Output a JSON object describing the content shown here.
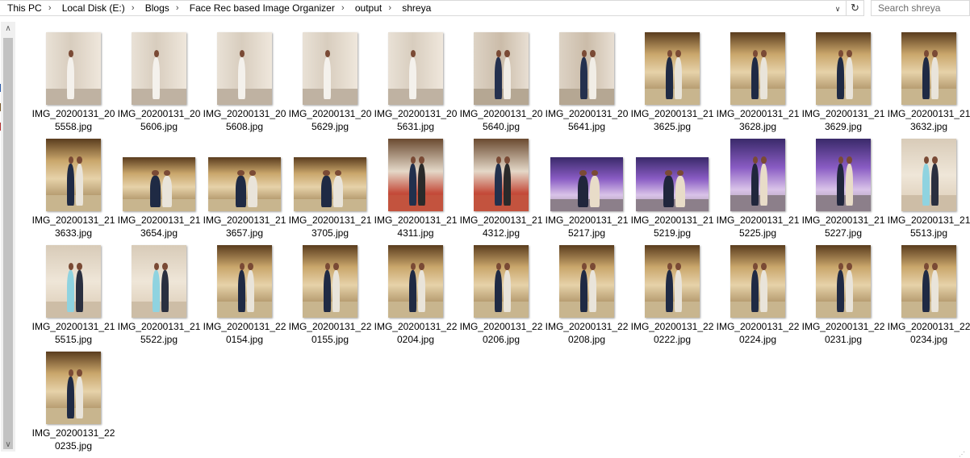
{
  "window": {
    "breadcrumbs": [
      "This PC",
      "Local Disk (E:)",
      "Blogs",
      "Face Rec based Image Organizer",
      "output",
      "shreya"
    ],
    "search_placeholder": "Search shreya",
    "icons": {
      "separator": "›",
      "dropdown": "∨",
      "refresh": "↻",
      "scroll_up": "∧",
      "scroll_down": "∨"
    },
    "colors": {
      "accent": "#1a73e8",
      "scrollbar_thumb": "#c2c2c2"
    }
  },
  "files": [
    {
      "name": "IMG_20200131_205558.jpg",
      "orient": "portrait",
      "tone": "hall"
    },
    {
      "name": "IMG_20200131_205606.jpg",
      "orient": "portrait",
      "tone": "hall"
    },
    {
      "name": "IMG_20200131_205608.jpg",
      "orient": "portrait",
      "tone": "hall"
    },
    {
      "name": "IMG_20200131_205629.jpg",
      "orient": "portrait",
      "tone": "hall"
    },
    {
      "name": "IMG_20200131_205631.jpg",
      "orient": "portrait",
      "tone": "hall"
    },
    {
      "name": "IMG_20200131_205640.jpg",
      "orient": "portrait",
      "tone": "hall2"
    },
    {
      "name": "IMG_20200131_205641.jpg",
      "orient": "portrait",
      "tone": "hall2"
    },
    {
      "name": "IMG_20200131_213625.jpg",
      "orient": "portrait",
      "tone": "gold"
    },
    {
      "name": "IMG_20200131_213628.jpg",
      "orient": "portrait",
      "tone": "gold"
    },
    {
      "name": "IMG_20200131_213629.jpg",
      "orient": "portrait",
      "tone": "gold"
    },
    {
      "name": "IMG_20200131_213632.jpg",
      "orient": "portrait",
      "tone": "gold"
    },
    {
      "name": "IMG_20200131_213633.jpg",
      "orient": "portrait",
      "tone": "gold"
    },
    {
      "name": "IMG_20200131_213654.jpg",
      "orient": "landscape",
      "tone": "gold"
    },
    {
      "name": "IMG_20200131_213657.jpg",
      "orient": "landscape",
      "tone": "gold"
    },
    {
      "name": "IMG_20200131_213705.jpg",
      "orient": "landscape",
      "tone": "gold"
    },
    {
      "name": "IMG_20200131_214311.jpg",
      "orient": "portrait",
      "tone": "red"
    },
    {
      "name": "IMG_20200131_214312.jpg",
      "orient": "portrait",
      "tone": "red"
    },
    {
      "name": "IMG_20200131_215217.jpg",
      "orient": "landscape",
      "tone": "purple"
    },
    {
      "name": "IMG_20200131_215219.jpg",
      "orient": "landscape",
      "tone": "purple"
    },
    {
      "name": "IMG_20200131_215225.jpg",
      "orient": "portrait",
      "tone": "purple"
    },
    {
      "name": "IMG_20200131_215227.jpg",
      "orient": "portrait",
      "tone": "purple"
    },
    {
      "name": "IMG_20200131_215513.jpg",
      "orient": "portrait",
      "tone": "cream"
    },
    {
      "name": "IMG_20200131_215515.jpg",
      "orient": "portrait",
      "tone": "cream"
    },
    {
      "name": "IMG_20200131_215522.jpg",
      "orient": "portrait",
      "tone": "cream"
    },
    {
      "name": "IMG_20200131_220154.jpg",
      "orient": "portrait",
      "tone": "gold"
    },
    {
      "name": "IMG_20200131_220155.jpg",
      "orient": "portrait",
      "tone": "gold"
    },
    {
      "name": "IMG_20200131_220204.jpg",
      "orient": "portrait",
      "tone": "gold"
    },
    {
      "name": "IMG_20200131_220206.jpg",
      "orient": "portrait",
      "tone": "gold"
    },
    {
      "name": "IMG_20200131_220208.jpg",
      "orient": "portrait",
      "tone": "gold"
    },
    {
      "name": "IMG_20200131_220222.jpg",
      "orient": "portrait",
      "tone": "gold"
    },
    {
      "name": "IMG_20200131_220224.jpg",
      "orient": "portrait",
      "tone": "gold"
    },
    {
      "name": "IMG_20200131_220231.jpg",
      "orient": "portrait",
      "tone": "gold"
    },
    {
      "name": "IMG_20200131_220234.jpg",
      "orient": "portrait",
      "tone": "gold"
    },
    {
      "name": "IMG_20200131_220235.jpg",
      "orient": "portrait",
      "tone": "gold"
    }
  ]
}
